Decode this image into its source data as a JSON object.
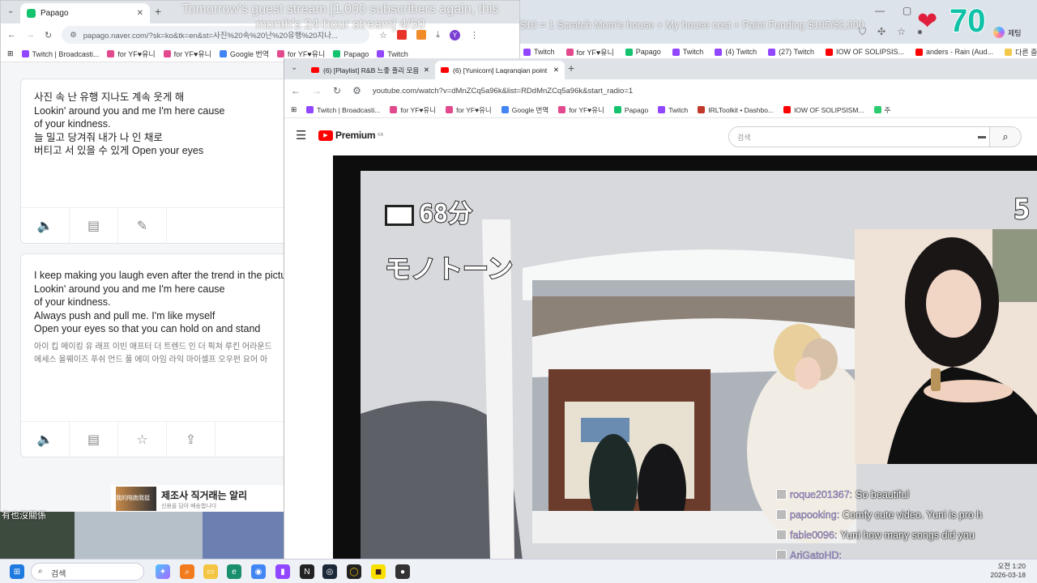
{
  "background_browser": {
    "stream_title": "Tomorrow's guest stream [1,000 subscribers again, this month's 24-hour stream] 4/50",
    "funding_text": "$10 = 1 Scratch Mom's house + My house cost + Paint Funding $105/$2,000",
    "bookmarks": [
      "Twitch",
      "for YF♥유니",
      "Papago",
      "Twitch",
      "(4) Twitch",
      "(27) Twitch",
      "IOW OF SOLIPSIS...",
      "anders - Rain (Aud..."
    ],
    "right_label": "다른 즐겨찾기",
    "follow_count": "70",
    "avatar_text": "제팅"
  },
  "papago_window": {
    "tab_title": "Papago",
    "url": "papago.naver.com/?sk=ko&tk=en&st=사진%20속%20난%20유행%20지나...",
    "bookmarks": [
      "Twitch | Broadcasti...",
      "for YF♥유니",
      "for YF♥유니",
      "Google 번역",
      "for YF♥유니",
      "Papago",
      "Twitch"
    ],
    "korean_lyrics": [
      "사진 속 난 유행 지나도 계속 웃게 해",
      "Lookin' around you and me I'm here cause",
      "of your kindness.",
      "늘 밀고 당겨줘 내가 나 인 채로",
      "버티고 서 있을 수 있게 Open your eyes"
    ],
    "english_lyrics": [
      "I keep making you laugh even after the trend in the picture",
      "Lookin' around you and me I'm here cause",
      "of your kindness.",
      "Always push and pull me. I'm like myself",
      "Open your eyes so that you can hold on and stand"
    ],
    "pronunciation": [
      "아이 킵 메이킹 유 래프 이빈 애프터 더 트렌드 인 더 픽쳐 루킨 어라운드",
      "에세스 올웨이즈 푸쉬 언드 풀 에미 아임 라익 마이셀프 오우펀 요어 아"
    ],
    "ad_headline": "제조사 직거래는 알리",
    "ad_sub": "신용을 담아 배송합니다",
    "ad_badge": "我的陪跑我挺"
  },
  "youtube_window": {
    "tabs": [
      {
        "title": "(6) [Playlist] R&B 느좋 플리 모음"
      },
      {
        "title": "(6) [Yunicorn] Laqranqian point"
      }
    ],
    "url": "youtube.com/watch?v=dMnZCq5a96k&list=RDdMnZCq5a96k&start_radio=1",
    "bookmarks": [
      "Twitch | Broadcasti...",
      "for YF♥유니",
      "for YF♥유니",
      "Google 번역",
      "for YF♥유니",
      "Papago",
      "Twitch",
      "IRLToolkit • Dashbo...",
      "IOW OF SOLIPSISM...",
      "주"
    ],
    "logo_text": "Premium",
    "logo_sup": "KR",
    "search_placeholder": "검색",
    "video_osd_time": "68分",
    "video_osd_title": "モノトーン",
    "video_osd_right": "5"
  },
  "side_caption": "有也沒關係",
  "chat": [
    {
      "user": "roque201367:",
      "message": "So beautiful"
    },
    {
      "user": "papooking:",
      "message": "Comfy cute video. Yuni is pro h"
    },
    {
      "user": "fable0096:",
      "message": "Yuni how many songs did you"
    },
    {
      "user": "AriGatoHD:",
      "message": ""
    }
  ],
  "taskbar": {
    "search_placeholder": "검색",
    "time": "오전 1:20",
    "date": "2026-03-18"
  },
  "colors": {
    "youtube_red": "#ff0000",
    "follow_count_color": "#10c2a8",
    "heart": "#e01f3d",
    "chat_username": "#b7a1ff"
  }
}
